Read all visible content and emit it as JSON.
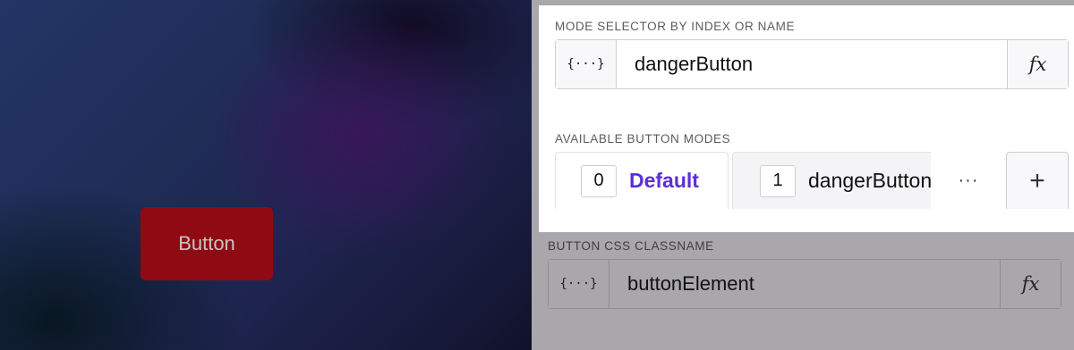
{
  "preview": {
    "button_label": "Button",
    "button_color": "#900a13"
  },
  "inspector": {
    "mode_selector": {
      "label": "MODE SELECTOR BY INDEX OR NAME",
      "bind_icon": "{···}",
      "value": "dangerButton",
      "fx_label": "fx"
    },
    "available_modes": {
      "label": "AVAILABLE BUTTON MODES",
      "modes": [
        {
          "index": "0",
          "name": "Default",
          "active": true
        },
        {
          "index": "1",
          "name": "dangerButton",
          "active": false
        }
      ],
      "more_icon": "···",
      "add_icon": "+"
    },
    "css_classname": {
      "label": "BUTTON CSS CLASSNAME",
      "bind_icon": "{···}",
      "value": "buttonElement",
      "fx_label": "fx"
    }
  },
  "colors": {
    "accent": "#5b2ed6",
    "danger": "#900a13"
  }
}
